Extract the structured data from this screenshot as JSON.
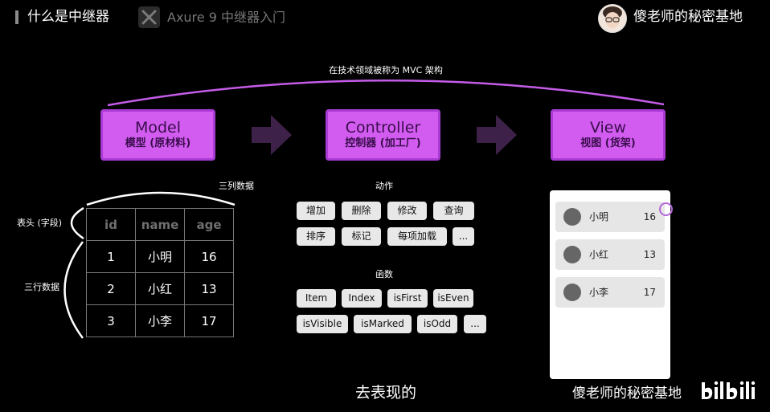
{
  "header": {
    "title": "什么是中继器",
    "course_title": "Axure 9 中继器入门",
    "author": "傻老师的秘密基地"
  },
  "diagram": {
    "caption": "在技术领域被称为 MVC 架构",
    "model": {
      "title": "Model",
      "subtitle": "模型 (原材料)"
    },
    "controller": {
      "title": "Controller",
      "subtitle": "控制器 (加工厂)"
    },
    "view": {
      "title": "View",
      "subtitle": "视图 (货架)"
    },
    "colors": {
      "box_fill": "#d25cf0",
      "box_border": "#a93ad4",
      "arrow": "#3d2148",
      "arc": "#c45ce8"
    }
  },
  "table_section": {
    "cols_label": "三列数据",
    "header_label": "表头 (字段)",
    "rows_label": "三行数据",
    "headers": [
      "id",
      "name",
      "age"
    ],
    "rows": [
      [
        "1",
        "小明",
        "16"
      ],
      [
        "2",
        "小红",
        "13"
      ],
      [
        "3",
        "小李",
        "17"
      ]
    ]
  },
  "actions": {
    "title": "动作",
    "row1": [
      "增加",
      "删除",
      "修改",
      "查询"
    ],
    "row2": [
      "排序",
      "标记",
      "每项加载",
      "..."
    ]
  },
  "functions": {
    "title": "函数",
    "row1": [
      "Item",
      "Index",
      "isFirst",
      "isEven"
    ],
    "row2": [
      "isVisible",
      "isMarked",
      "isOdd",
      "..."
    ]
  },
  "view_list": [
    {
      "name": "小明",
      "age": "16"
    },
    {
      "name": "小红",
      "age": "13"
    },
    {
      "name": "小李",
      "age": "17"
    }
  ],
  "subtitle": "去表现的",
  "watermark": "傻老师的秘密基地",
  "logo_text": "bilibili"
}
